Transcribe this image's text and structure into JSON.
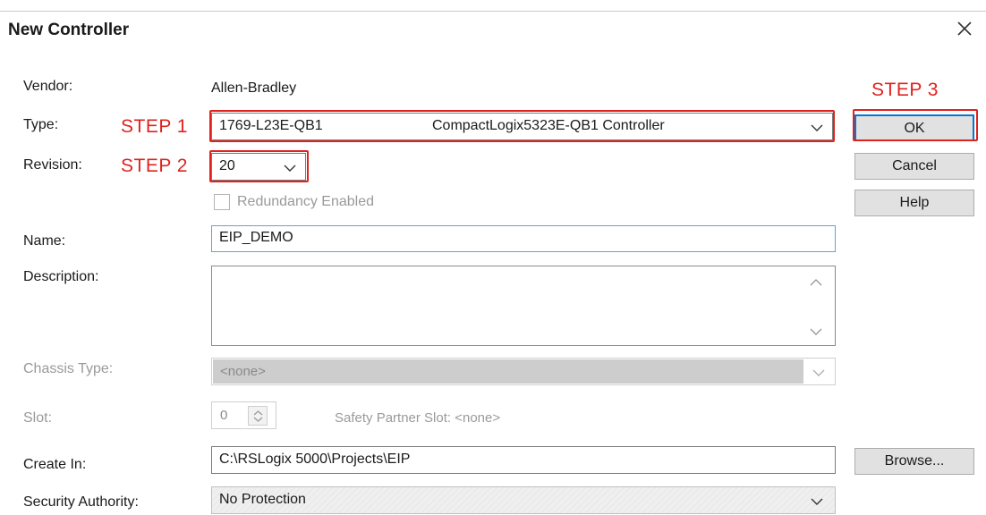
{
  "window": {
    "title": "New Controller",
    "close_icon": "close-icon"
  },
  "vendor": {
    "label": "Vendor:",
    "value": "Allen-Bradley"
  },
  "type": {
    "label": "Type:",
    "step": "STEP 1",
    "part": "1769-L23E-QB1",
    "description": "CompactLogix5323E-QB1 Controller"
  },
  "revision": {
    "label": "Revision:",
    "step": "STEP 2",
    "value": "20"
  },
  "redundancy": {
    "label": "Redundancy Enabled",
    "checked": false
  },
  "name": {
    "label": "Name:",
    "value": "EIP_DEMO"
  },
  "description": {
    "label": "Description:",
    "value": ""
  },
  "chassis": {
    "label": "Chassis Type:",
    "value": "<none>"
  },
  "slot": {
    "label": "Slot:",
    "value": "0",
    "safety_partner": "Safety Partner Slot: <none>"
  },
  "create_in": {
    "label": "Create In:",
    "value": "C:\\RSLogix 5000\\Projects\\EIP"
  },
  "security": {
    "label": "Security Authority:",
    "value": "No Protection"
  },
  "buttons": {
    "step": "STEP 3",
    "ok": "OK",
    "cancel": "Cancel",
    "help": "Help",
    "browse": "Browse..."
  },
  "colors": {
    "annotation": "#e0221e",
    "focus": "#0078d7",
    "button_bg": "#e1e1e1"
  }
}
